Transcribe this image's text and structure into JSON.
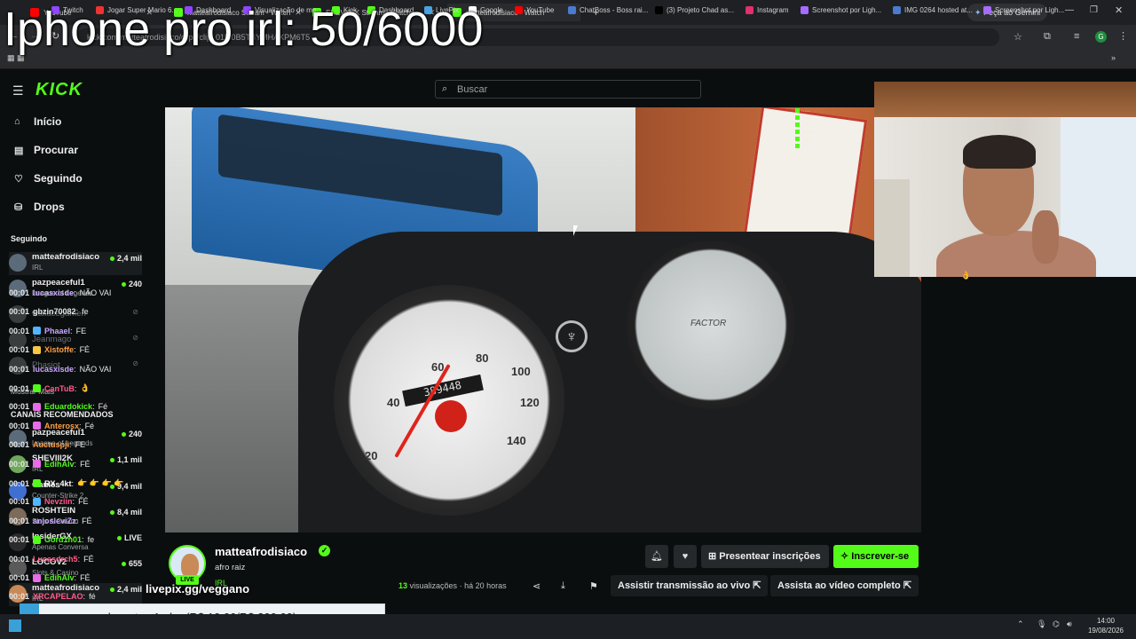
{
  "overlay_title": "Iphone pro irl: 50/6000",
  "browser": {
    "tabs": [
      {
        "label": "YouTube",
        "color": "#ff0000"
      },
      {
        "label": "matteafrodisiaco Stream - Watch",
        "color": "#53fc18"
      },
      {
        "label": "SHEVIII2K Stream - Watch",
        "color": "#53fc18"
      },
      {
        "label": "matteafrodisiaco - Watch",
        "color": "#53fc18"
      }
    ],
    "new_tab": "+",
    "gemini_button": "Peça ao Gemini",
    "url": "kick.com/matteafrodisiaco/clips/clip_01M0B5TBYMHAXPM6T5",
    "bookmarks": [
      {
        "label": "Twitch",
        "color": "#9146ff"
      },
      {
        "label": "Jogar Super Mario 6...",
        "color": "#e33"
      },
      {
        "label": "Dashboard",
        "color": "#9146ff"
      },
      {
        "label": "Visualização de mo...",
        "color": "#9146ff"
      },
      {
        "label": "Kick",
        "color": "#53fc18"
      },
      {
        "label": "Dashboard",
        "color": "#53fc18"
      },
      {
        "label": "LivePix",
        "color": "#4aa3df"
      },
      {
        "label": "Google",
        "color": "#ffffff"
      },
      {
        "label": "YouTube",
        "color": "#ff0000"
      },
      {
        "label": "ChatBoss - Boss rai...",
        "color": "#4a7bd0"
      },
      {
        "label": "(3) Projeto Chad as...",
        "color": "#000000"
      },
      {
        "label": "Instagram",
        "color": "#e1306c"
      },
      {
        "label": "Screenshot por Ligh...",
        "color": "#a66cff"
      },
      {
        "label": "IMG 0264 hosted at...",
        "color": "#4a7bd0"
      },
      {
        "label": "Screenshot por Ligh...",
        "color": "#a66cff"
      }
    ]
  },
  "kick": {
    "logo": "KICK",
    "search_placeholder": "Buscar",
    "nav": [
      {
        "label": "Início",
        "icon": "home-icon",
        "glyph": "⌂"
      },
      {
        "label": "Procurar",
        "icon": "browse-icon",
        "glyph": "▤"
      },
      {
        "label": "Seguindo",
        "icon": "heart-icon",
        "glyph": "♡"
      },
      {
        "label": "Drops",
        "icon": "drops-icon",
        "glyph": "⛁"
      }
    ],
    "following_heading": "Seguindo",
    "following": [
      {
        "name": "matteafrodisiaco",
        "category": "IRL",
        "viewers": "2,4 mil",
        "live": true
      },
      {
        "name": "pazpeaceful1",
        "category": "League of Legends",
        "viewers": "240",
        "live": true
      },
      {
        "name": "wallacegamerr",
        "live": false
      },
      {
        "name": "Jeanmago",
        "live": false
      },
      {
        "name": "Phasiot",
        "live": false
      }
    ],
    "show_more": "Mostrar Mais",
    "recommended_heading": "CANAIS RECOMENDADOS",
    "recommended": [
      {
        "name": "pazpeaceful1",
        "category": "League of Legends",
        "viewers": "240"
      },
      {
        "name": "SHEVIII2K",
        "category": "IRL",
        "viewers": "1,1 mil"
      },
      {
        "name": "Gaules",
        "category": "Counter-Strike 2",
        "viewers": "9,4 mil"
      },
      {
        "name": "ROSHTEIN",
        "category": "Slots & Casino",
        "viewers": "8,4 mil"
      },
      {
        "name": "InsiderGX",
        "category": "Apenas Conversa",
        "viewers": "LIVE"
      },
      {
        "name": "LOCOV2",
        "category": "Slots & Casino",
        "viewers": "655"
      },
      {
        "name": "matteafrodisiaco",
        "category": "IRL",
        "viewers": "2,4 mil"
      }
    ],
    "channel": {
      "name": "matteafrodisiaco",
      "title": "afro raiz",
      "category": "IRL",
      "live_badge": "LIVE",
      "verified": "✓",
      "gift_label": "Presentear inscrições",
      "subscribe_label": "Inscrever-se",
      "views_count": "13",
      "views_label": "visualizações",
      "time_ago": "há 20 horas",
      "watch_live": "Assistir transmissão ao vivo",
      "watch_full": "Assista ao vídeo completo"
    },
    "overlay_livepix": "livepix.gg/veggano",
    "donation": "barretos 1 obg (R$ 10,00/R$ 200,00)",
    "chat": [
      {
        "time": "00:01",
        "user": "lucasxisde",
        "color": "#c9a7ff",
        "text": "NÃO VAI",
        "badge": ""
      },
      {
        "time": "00:01",
        "user": "gbzin70082",
        "color": "#e6e6e6",
        "text": "fe",
        "badge": ""
      },
      {
        "time": "00:01",
        "user": "Phaael",
        "color": "#c9a7ff",
        "text": "FE",
        "badge": "#4fb6ff"
      },
      {
        "time": "00:01",
        "user": "Xistoffe",
        "color": "#ff9f43",
        "text": "FÉ",
        "badge": "#f6c744"
      },
      {
        "time": "00:01",
        "user": "lucasxisde",
        "color": "#c9a7ff",
        "text": "NÃO VAI",
        "badge": ""
      },
      {
        "time": "00:01",
        "user": "CanTuB",
        "color": "#ff5b8a",
        "text": "👌",
        "badge": "#53fc18"
      },
      {
        "time": "00:01",
        "user": "Eduardokick",
        "color": "#53fc18",
        "text": "Fé",
        "badge": "#e86ce8"
      },
      {
        "time": "00:01",
        "user": "Anterosx",
        "color": "#ff9f43",
        "text": "Fé",
        "badge": "#e86ce8"
      },
      {
        "time": "00:01",
        "user": "Auctuspji",
        "color": "#ff9f43",
        "text": "FE",
        "badge": ""
      },
      {
        "time": "00:01",
        "user": "EdihAlv",
        "color": "#53fc18",
        "text": "FÉ",
        "badge": "#e86ce8"
      },
      {
        "time": "00:01",
        "user": "RX_4kt",
        "color": "#ffffff",
        "text": "👉 👉 👉 👉",
        "badge": "#53fc18"
      },
      {
        "time": "00:01",
        "user": "Nevziin",
        "color": "#ff5b8a",
        "text": "FÉ",
        "badge": "#4fb6ff"
      },
      {
        "time": "00:01",
        "user": "anjosleviZz",
        "color": "#c9a7ff",
        "text": "FÉ",
        "badge": ""
      },
      {
        "time": "00:01",
        "user": "Gord1n01",
        "color": "#53fc18",
        "text": "fe",
        "badge": "#53fc18"
      },
      {
        "time": "00:01",
        "user": "Lucasdrch5",
        "color": "#ff5b8a",
        "text": "FÉ",
        "badge": ""
      },
      {
        "time": "00:01",
        "user": "EdihAlv",
        "color": "#53fc18",
        "text": "FÉ",
        "badge": "#e86ce8"
      },
      {
        "time": "00:01",
        "user": "XRCAPELAO",
        "color": "#ff5b8a",
        "text": "fé",
        "badge": ""
      }
    ]
  },
  "taskbar": {
    "time": "14:00",
    "date": "19/08/2026"
  },
  "colors": {
    "kick_green": "#53fc18",
    "background": "#0b0e0f"
  }
}
